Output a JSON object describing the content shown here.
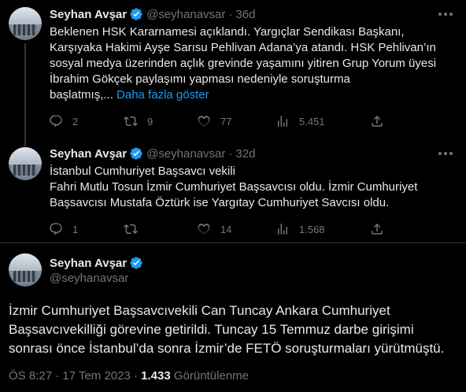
{
  "tweets": [
    {
      "name": "Seyhan Avşar",
      "handle": "@seyhanavsar",
      "dot": "·",
      "time": "36d",
      "text": "Beklenen HSK Kararnamesi açıklandı. Yargıçlar Sendikası Başkanı,\nKarşıyaka Hakimi Ayşe Sarısu Pehlivan Adana’ya atandı. HSK Pehlivan’ın\nsosyal medya üzerinden açlık grevinde yaşamını yitiren Grup Yorum üyesi\nİbrahim Gökçek paylaşımı yapması nedeniyle soruşturma\nbaşlatmış,...",
      "show_more": "Daha fazla göster",
      "replies": "2",
      "retweets": "9",
      "likes": "77",
      "views": "5.451"
    },
    {
      "name": "Seyhan Avşar",
      "handle": "@seyhanavsar",
      "dot": "·",
      "time": "32d",
      "text": "İstanbul Cumhuriyet Başsavcı vekili\nFahri Mutlu Tosun İzmir Cumhuriyet Başsavcısı oldu. İzmir Cumhuriyet\nBaşsavcısı Mustafa Öztürk ise Yargıtay Cumhuriyet Savcısı oldu.",
      "replies": "1",
      "retweets": "",
      "likes": "14",
      "views": "1.568"
    }
  ],
  "main": {
    "name": "Seyhan Avşar",
    "handle": "@seyhanavsar",
    "text": "İzmir Cumhuriyet Başsavcıvekili Can Tuncay Ankara Cumhuriyet\nBaşsavcıvekilliği görevine getirildi. Tuncay 15 Temmuz darbe girişimi\nsonrası önce İstanbul’da sonra İzmir’de FETÖ soruşturmaları yürütmüştü.",
    "timestamp": "ÖS 8:27 · 17 Tem 2023 · ",
    "views_count": "1.433",
    "views_label": " Görüntülenme"
  },
  "colors": {
    "background": "#000000",
    "text": "#e7e9ea",
    "secondary": "#71767b",
    "accent": "#1d9bf0",
    "divider": "#2f3336"
  },
  "icons": [
    "verified-badge-icon",
    "more-icon",
    "reply-icon",
    "retweet-icon",
    "like-icon",
    "views-icon",
    "share-icon"
  ]
}
